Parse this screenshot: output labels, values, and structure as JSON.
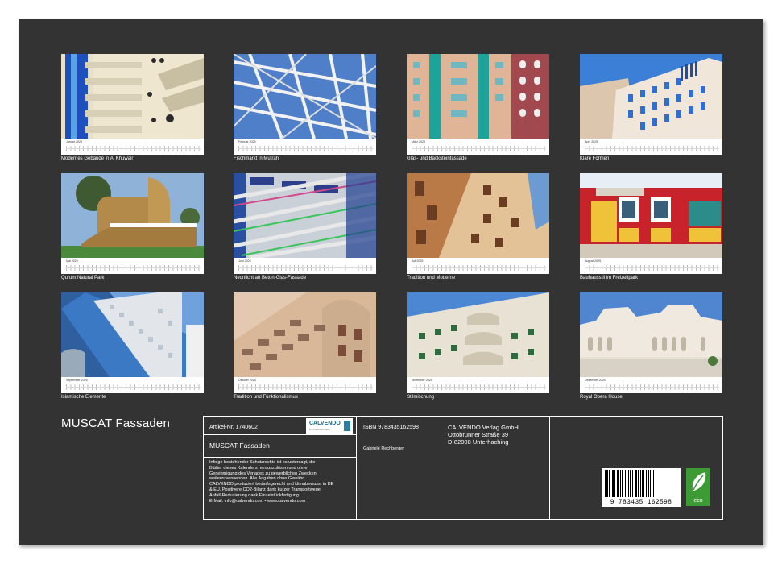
{
  "calendar_title": "MUSCAT Fassaden",
  "months": [
    {
      "label": "Januar 2025",
      "caption": "Modernes Gebäude in Al Khuwair"
    },
    {
      "label": "Februar 2025",
      "caption": "Fischmarkt in Mutrah"
    },
    {
      "label": "März 2025",
      "caption": "Glas- und Backsteinfassade"
    },
    {
      "label": "April 2025",
      "caption": "Klare Formen"
    },
    {
      "label": "Mai 2025",
      "caption": "Qurum Natural Park"
    },
    {
      "label": "Juni 2025",
      "caption": "Neonlicht an Beton-Glas-Fassade"
    },
    {
      "label": "Juli 2025",
      "caption": "Tradition und Moderne"
    },
    {
      "label": "August 2025",
      "caption": "Bauhausstil im Freizeitpark"
    },
    {
      "label": "September 2025",
      "caption": "Islamische Elemente"
    },
    {
      "label": "Oktober 2025",
      "caption": "Tradition und Funktionalismus"
    },
    {
      "label": "November 2025",
      "caption": "Stilmischung"
    },
    {
      "label": "Dezember 2025",
      "caption": "Royal Opera House"
    }
  ],
  "info": {
    "article_no": "Artikel-Nr. 1740602",
    "product_title": "MUSCAT Fassaden",
    "logo_text": "CALVENDO",
    "logo_subtext": "Die Kalendermarke",
    "isbn": "ISBN 9783435162598",
    "author": "Gabriele Rechberger",
    "publisher_name": "CALVENDO Verlag GmbH",
    "publisher_street": "Ottobrunner Straße 39",
    "publisher_city": "D-82008 Unterhaching",
    "legal_lines": [
      "Infolge bestehender Schutzrechte ist es untersagt, die",
      "Blätter dieses Kalenders herauszulösen und ohne",
      "Genehmigung des Verlages zu gewerblichen Zwecken",
      "weiterzuverwenden. Alle Angaben ohne Gewähr.",
      "CALVENDO produziert bedarfsgerecht und klimabewusst in DE",
      "& EU. Positivere CO2-Bilanz dank kurzer Transportwege.",
      "Abfall-Reduzierung dank Einzelstückfertigung.",
      "E-Mail: info@calvendo.com • www.calvendo.com"
    ],
    "barcode_number": "9 783435 162598",
    "eco_label": "eco"
  },
  "colors": {
    "sheet": "#333333",
    "eco_green": "#3d9b35",
    "logo_blue": "#1a6e8a"
  }
}
